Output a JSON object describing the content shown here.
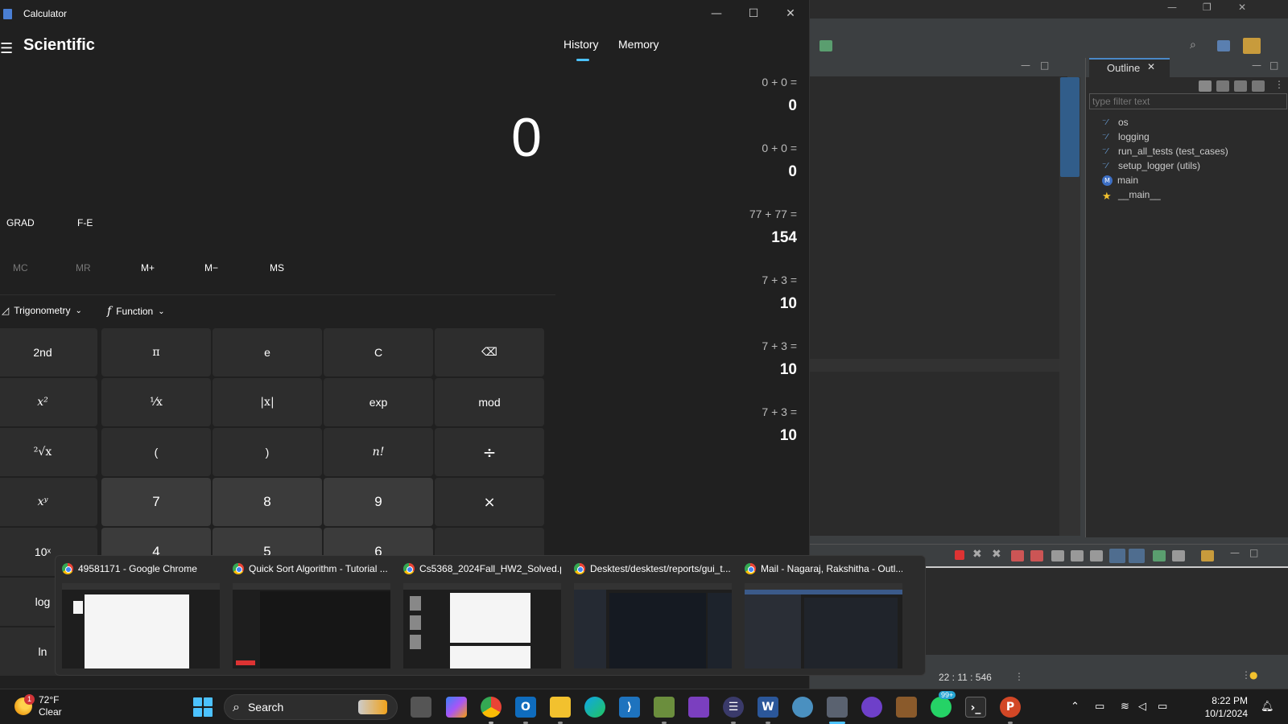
{
  "calculator": {
    "window_title": "Calculator",
    "mode": "Scientific",
    "display_value": "0",
    "angle_mode": "GRAD",
    "fe_label": "F-E",
    "memory": [
      "MC",
      "MR",
      "M+",
      "M−",
      "MS"
    ],
    "dropdowns": {
      "trig": "Trigonometry",
      "func": "Function"
    },
    "keys": [
      [
        "2nd",
        "π",
        "e",
        "C",
        "⌫"
      ],
      [
        "x²",
        "¹⁄x",
        "|x|",
        "exp",
        "mod"
      ],
      [
        "²√x",
        "(",
        ")",
        "n!",
        "÷"
      ],
      [
        "xʸ",
        "7",
        "8",
        "9",
        "×"
      ],
      [
        "10ˣ",
        "4",
        "5",
        "6",
        ""
      ],
      [
        "log",
        "",
        "",
        "",
        ""
      ],
      [
        "ln",
        "",
        "",
        "",
        ""
      ]
    ],
    "panel_tabs": {
      "history": "History",
      "memory": "Memory"
    },
    "history": [
      {
        "expr": "0   +   0 =",
        "result": "0"
      },
      {
        "expr": "0   +   0 =",
        "result": "0"
      },
      {
        "expr": "77   +   77 =",
        "result": "154"
      },
      {
        "expr": "7   +   3 =",
        "result": "10"
      },
      {
        "expr": "7   +   3 =",
        "result": "10"
      },
      {
        "expr": "7   +   3 =",
        "result": "10"
      }
    ]
  },
  "eclipse": {
    "outline_tab": "Outline",
    "filter_placeholder": "type filter text",
    "outline_items": [
      {
        "label": "os",
        "icon": "import-icon"
      },
      {
        "label": "logging",
        "icon": "import-icon"
      },
      {
        "label": "run_all_tests (test_cases)",
        "icon": "import-icon"
      },
      {
        "label": "setup_logger (utils)",
        "icon": "import-icon"
      },
      {
        "label": "main",
        "icon": "function-icon"
      },
      {
        "label": "__main__",
        "icon": "main-star-icon"
      }
    ],
    "status_position": "22 : 11 : 546"
  },
  "task_previews": [
    {
      "title": "49581171 - Google Chrome"
    },
    {
      "title": "Quick Sort Algorithm - Tutorial ..."
    },
    {
      "title": "Cs5368_2024Fall_HW2_Solved.p..."
    },
    {
      "title": "Desktest/desktest/reports/gui_t..."
    },
    {
      "title": "Mail - Nagaraj, Rakshitha - Outl..."
    }
  ],
  "taskbar": {
    "weather_temp": "72°F",
    "weather_desc": "Clear",
    "weather_badge": "1",
    "search_label": "Search",
    "whatsapp_badge": "99+",
    "time": "8:22 PM",
    "date": "10/1/2024"
  },
  "colors": {
    "accent": "#4cc2ff",
    "calc_bg": "#202020",
    "key_bg": "#3b3b3b"
  }
}
